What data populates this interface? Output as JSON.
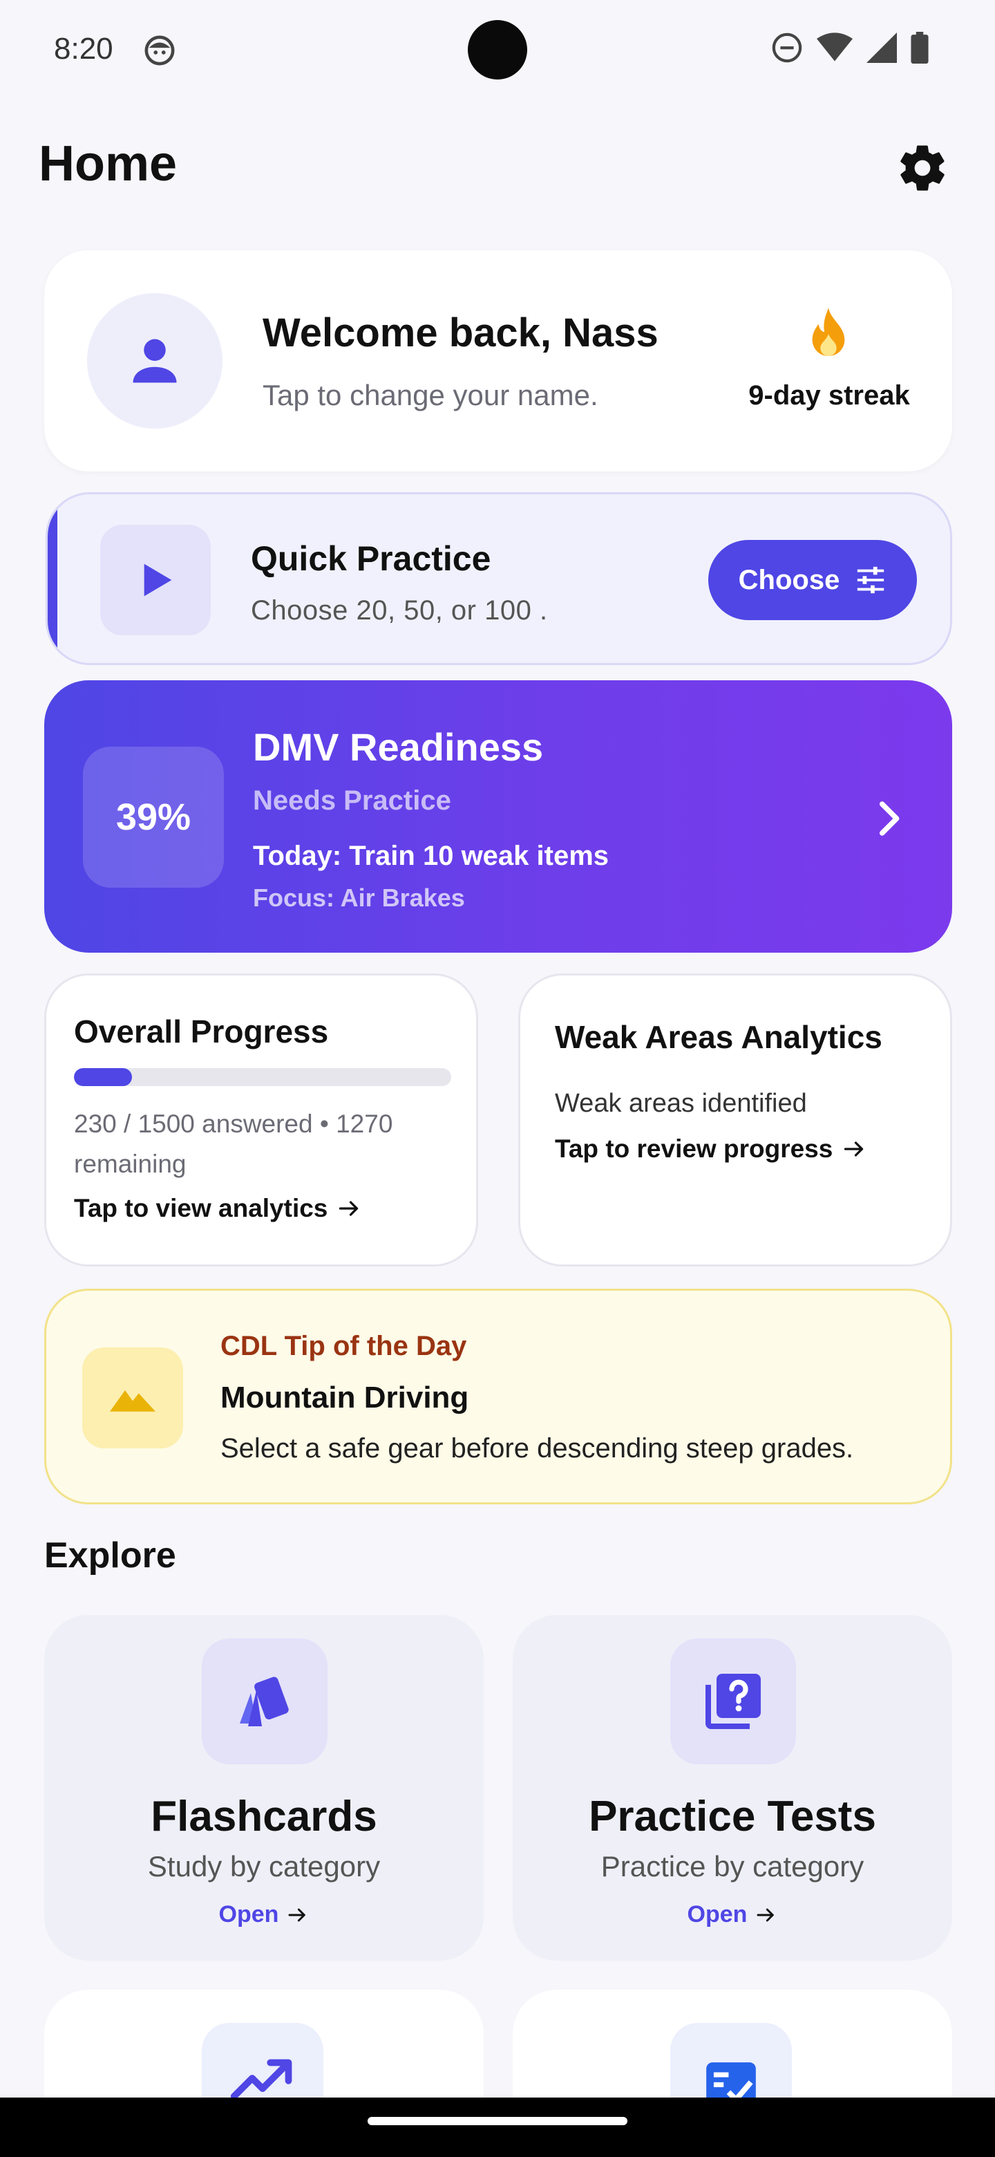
{
  "status_bar": {
    "time": "8:20",
    "icons": [
      "face-icon",
      "dnd-icon",
      "wifi-icon",
      "signal-icon",
      "battery-icon"
    ]
  },
  "header": {
    "title": "Home",
    "settings_icon": "gear-icon"
  },
  "welcome": {
    "title": "Welcome back, Nass",
    "subtitle": "Tap to change your name.",
    "streak": "9-day streak",
    "avatar_icon": "person-icon",
    "streak_icon": "flame-icon"
  },
  "quick_practice": {
    "title": "Quick Practice",
    "subtitle": "Choose 20, 50, or 100 .",
    "button_label": "Choose",
    "icon": "play-icon"
  },
  "readiness": {
    "percent": "39%",
    "title": "DMV Readiness",
    "status": "Needs Practice",
    "today": "Today: Train 10 weak items",
    "focus": "Focus: Air Brakes"
  },
  "overall_progress": {
    "title": "Overall Progress",
    "answered": "230 / 1500 answered • 1270 remaining",
    "fraction": 0.153,
    "link": "Tap to view analytics"
  },
  "weak_areas": {
    "title": "Weak Areas Analytics",
    "subtitle": "Weak areas identified",
    "link": "Tap to review progress"
  },
  "tip": {
    "label": "CDL Tip of the Day",
    "title": "Mountain Driving",
    "body": "Select a safe gear before descending steep grades.",
    "icon": "mountain-icon"
  },
  "explore": {
    "title": "Explore",
    "tiles": [
      {
        "title": "Flashcards",
        "subtitle": "Study by category",
        "open": "Open",
        "icon": "cards-icon"
      },
      {
        "title": "Practice Tests",
        "subtitle": "Practice by category",
        "open": "Open",
        "icon": "quiz-icon"
      },
      {
        "icon": "trending-up-icon"
      },
      {
        "icon": "checklist-icon"
      }
    ]
  },
  "colors": {
    "primary": "#4F46E5",
    "gradient_end": "#7C3AED",
    "streak_orange": "#F59E0B",
    "tip_bg": "#FEFBE8",
    "tip_label": "#9A3412"
  }
}
